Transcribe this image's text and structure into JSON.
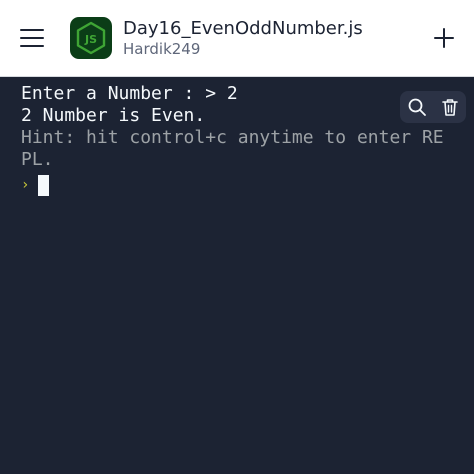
{
  "header": {
    "menu_icon": "hamburger-menu-icon",
    "file_icon": "nodejs-icon",
    "file_icon_label": "JS",
    "title": "Day16_EvenOddNumber.js",
    "owner": "Hardik249",
    "add_icon": "plus-icon"
  },
  "console": {
    "lines": [
      "Enter a Number : > 2",
      "2 Number is Even."
    ],
    "hint": "Hint: hit control+c anytime to enter REPL.",
    "prompt_glyph": "›",
    "tools": {
      "search_icon": "search-icon",
      "clear_icon": "trash-icon"
    }
  },
  "colors": {
    "background": "#1c2333",
    "header_background": "#ffffff",
    "text": "#f5f9fc",
    "hint": "#9da2a6",
    "prompt": "#c9c83a",
    "node_green": "#3fa535"
  }
}
